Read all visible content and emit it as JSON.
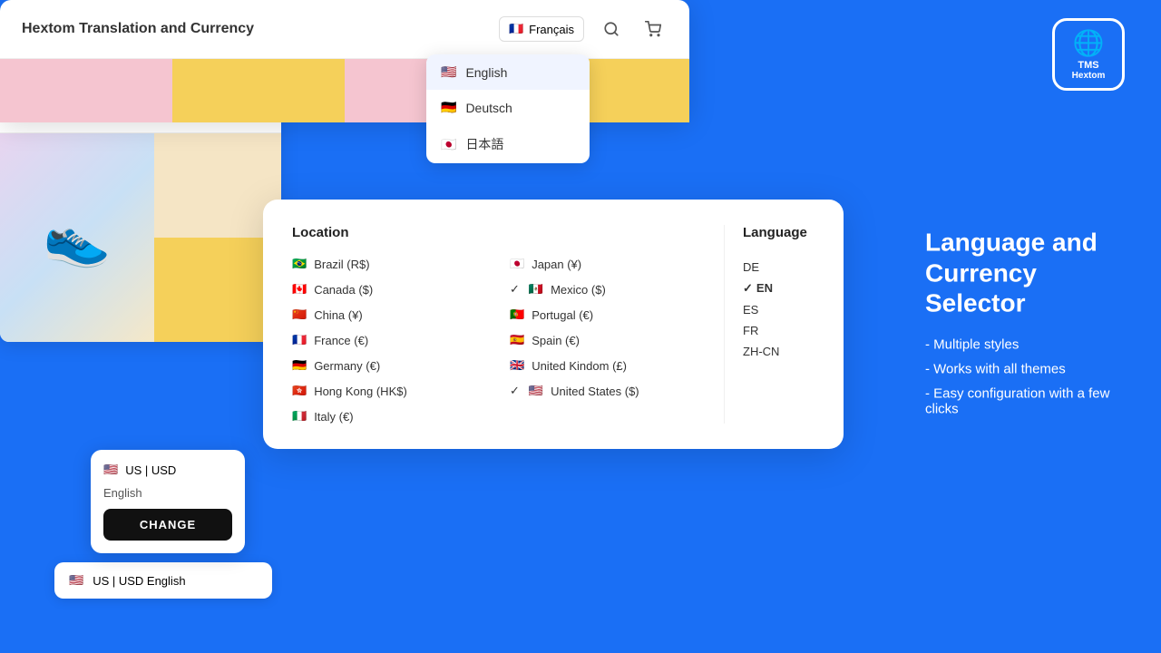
{
  "app": {
    "title": "Hextom Translation and Currency",
    "tms_label": "TMS",
    "hextom_label": "Hextom"
  },
  "right_panel": {
    "heading": "Language and Currency Selector",
    "features": [
      "- Multiple styles",
      "- Works with all themes",
      "- Easy configuration with   a few clicks"
    ]
  },
  "header": {
    "title": "Hextom Translation and Currency",
    "current_lang_label": "Français"
  },
  "lang_dropdown": {
    "items": [
      {
        "flag": "🇺🇸",
        "label": "English"
      },
      {
        "flag": "🇩🇪",
        "label": "Deutsch"
      },
      {
        "flag": "🇯🇵",
        "label": "日本語"
      }
    ]
  },
  "location_modal": {
    "location_title": "Location",
    "language_title": "Language",
    "locations": [
      {
        "flag": "🇧🇷",
        "label": "Brazil (R$)",
        "checked": false
      },
      {
        "flag": "🇯🇵",
        "label": "Japan (¥)",
        "checked": false
      },
      {
        "flag": "🇨🇦",
        "label": "Canada ($)",
        "checked": false
      },
      {
        "flag": "🇲🇽",
        "label": "Mexico ($)",
        "checked": true
      },
      {
        "flag": "🇨🇳",
        "label": "China (¥)",
        "checked": false
      },
      {
        "flag": "🇵🇹",
        "label": "Portugal (€)",
        "checked": false
      },
      {
        "flag": "🇫🇷",
        "label": "France (€)",
        "checked": false
      },
      {
        "flag": "🇪🇸",
        "label": "Spain (€)",
        "checked": false
      },
      {
        "flag": "🇩🇪",
        "label": "Germany (€)",
        "checked": false
      },
      {
        "flag": "🇬🇧",
        "label": "United Kindom (£)",
        "checked": false
      },
      {
        "flag": "🇭🇰",
        "label": "Hong Kong (HK$)",
        "checked": false
      },
      {
        "flag": "🇺🇸",
        "label": "United States ($)",
        "checked": true
      },
      {
        "flag": "🇮🇹",
        "label": "Italy (€)",
        "checked": false
      }
    ],
    "languages": [
      {
        "code": "DE",
        "active": false
      },
      {
        "code": "EN",
        "active": true
      },
      {
        "code": "ES",
        "active": false
      },
      {
        "code": "FR",
        "active": false
      },
      {
        "code": "ZH-CN",
        "active": false
      }
    ]
  },
  "selector_widget": {
    "currency": "US | USD",
    "language": "English",
    "button_label": "CHANGE"
  },
  "status_bar": {
    "label": "US | USD English"
  }
}
